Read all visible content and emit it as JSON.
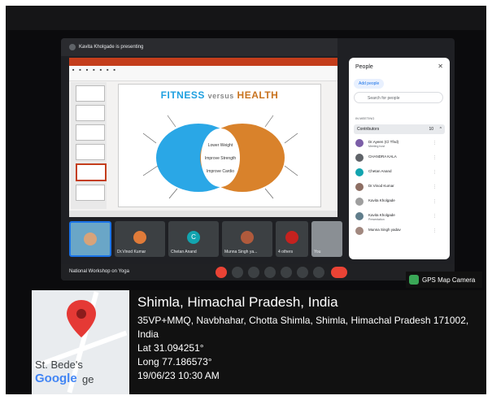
{
  "meet": {
    "presenting_banner": "Kavita Kholgade is presenting",
    "meeting_title": "National Workshop on Yoga",
    "slide": {
      "title_part1": "FITNESS",
      "title_part2": "versus",
      "title_part3": "HEALTH",
      "center_labels": [
        "Lower Weight",
        "Improve Strength",
        "Improve Cardio"
      ]
    },
    "tiles": [
      {
        "name": "",
        "initial": ""
      },
      {
        "name": "Dr.Vinod Kumar",
        "initial": ""
      },
      {
        "name": "Chetan Anand",
        "initial": "C"
      },
      {
        "name": "Munna Singh ya...",
        "initial": ""
      },
      {
        "name": "4 others",
        "initial": ""
      },
      {
        "name": "You",
        "initial": ""
      }
    ]
  },
  "people_panel": {
    "header": "People",
    "add_people": "Add people",
    "search_placeholder": "Search for people",
    "section": "IN MEETING",
    "contributors_label": "Contributors",
    "contributors_count": "10",
    "participants": [
      {
        "name": "Dr.Ayeen (Cl Tfnd)",
        "sub": "Meeting host",
        "color": "#7b5ea7"
      },
      {
        "name": "CHANDRA KALA",
        "sub": "",
        "color": "#5f6368"
      },
      {
        "name": "Chetan Anand",
        "sub": "",
        "color": "#12a4af"
      },
      {
        "name": "Dr.Vinod Kumar",
        "sub": "",
        "color": "#8d6e63"
      },
      {
        "name": "Kavita Kholgade",
        "sub": "",
        "color": "#9e9e9e"
      },
      {
        "name": "Kavita Kholgade",
        "sub": "Presentation",
        "color": "#607d8b"
      },
      {
        "name": "Munna Singh yadav",
        "sub": "",
        "color": "#a1887f"
      }
    ]
  },
  "gps": {
    "badge": "GPS Map Camera",
    "city": "Shimla, Himachal Pradesh, India",
    "address_line1": "35VP+MMQ, Navbhahar, Chotta Shimla, Shimla, Himachal Pradesh 171002,",
    "address_line2": "India",
    "lat": "Lat 31.094251°",
    "long": "Long 77.186573°",
    "datetime": "19/06/23 10:30 AM",
    "map_label": "St. Bede's",
    "map_label2": "ge",
    "brand": "Google"
  }
}
